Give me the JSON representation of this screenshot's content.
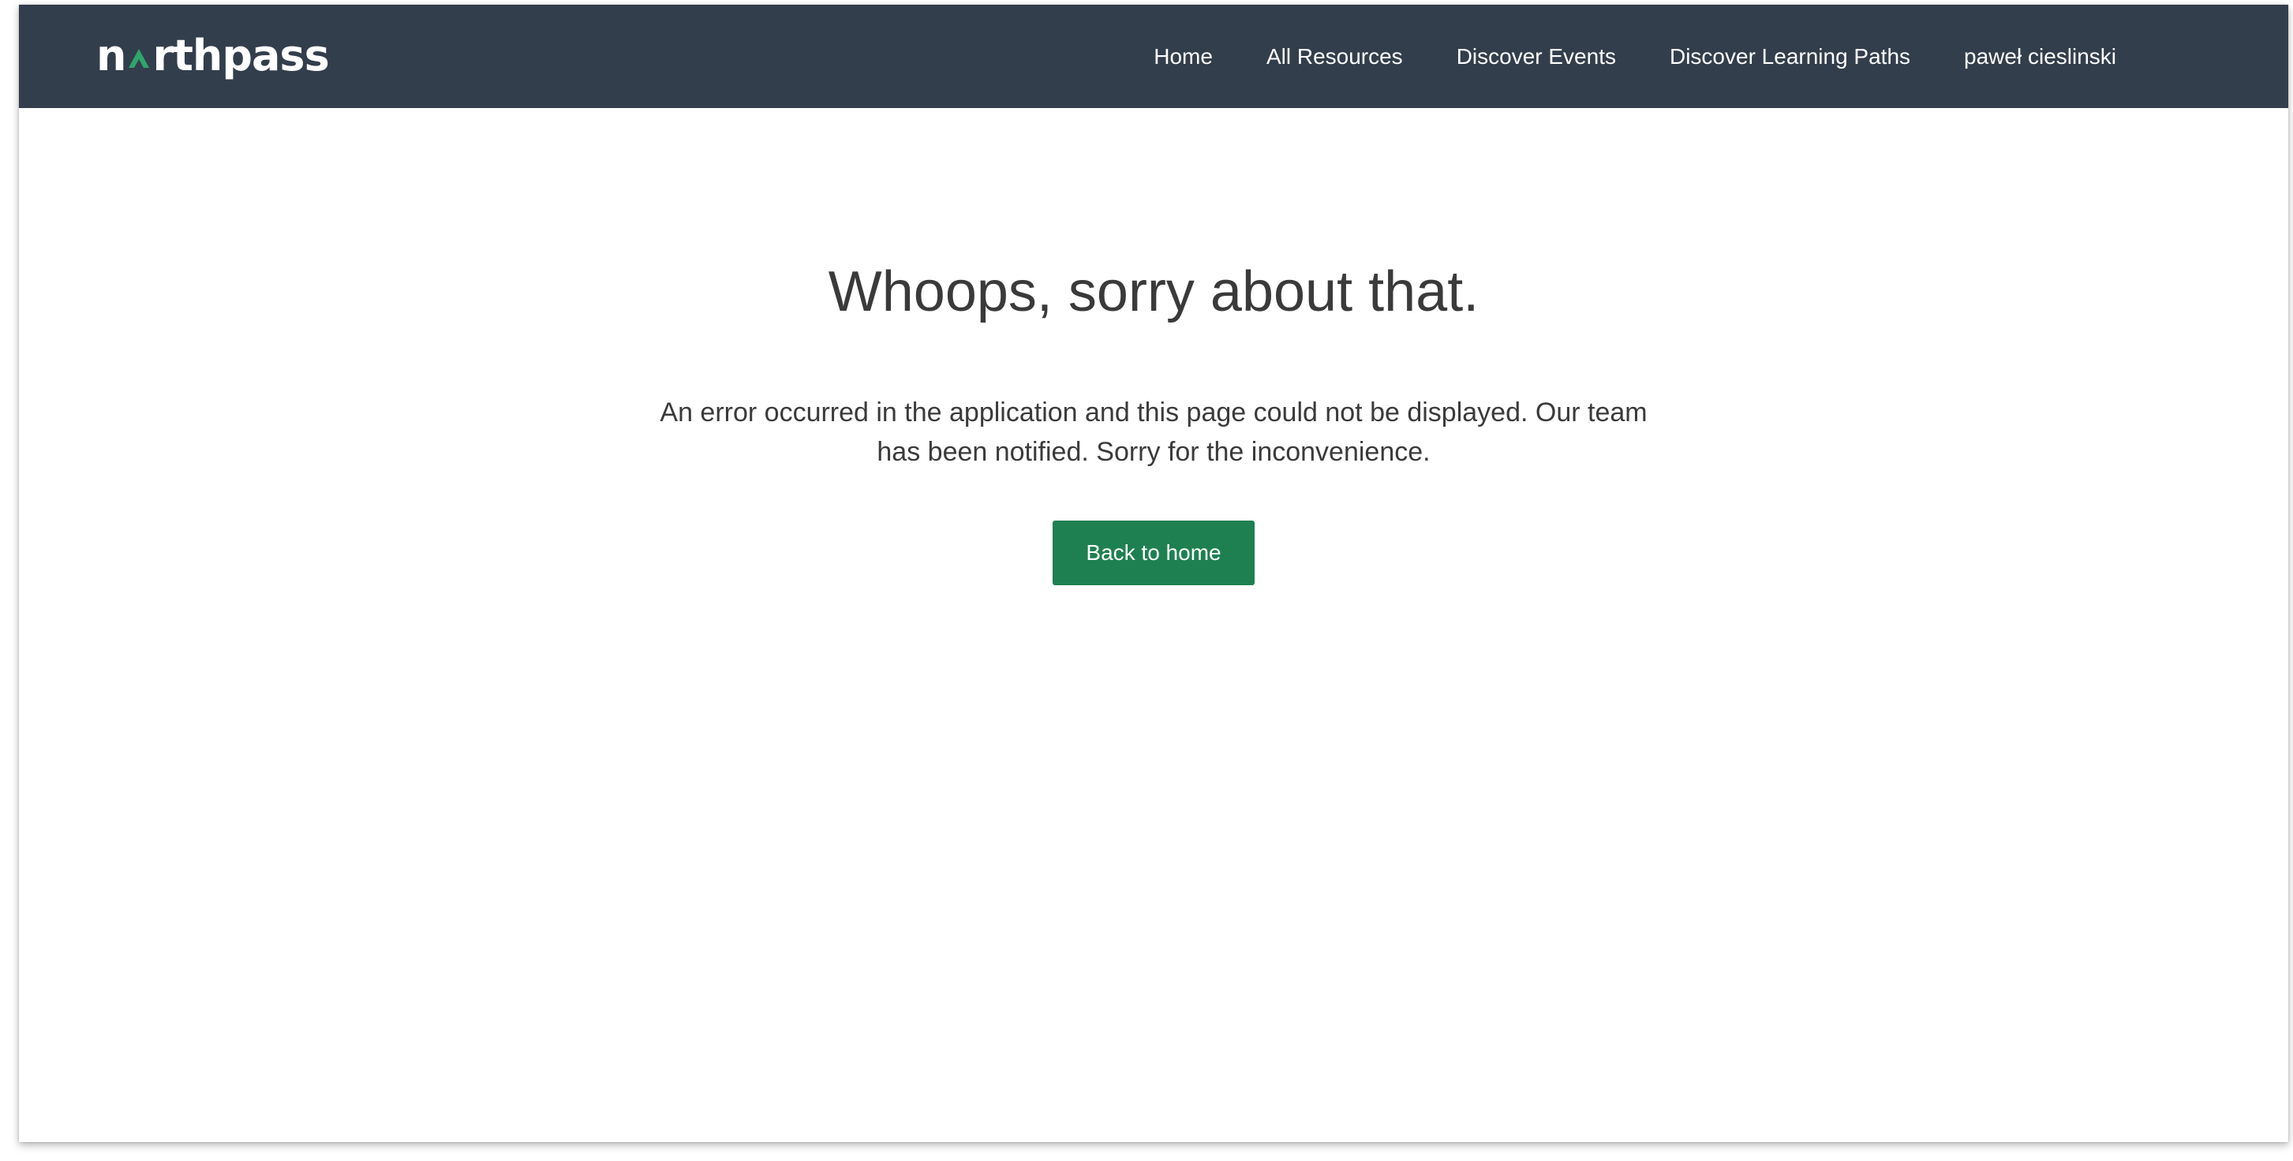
{
  "header": {
    "logo": {
      "text_before_mark": "n",
      "text_after_mark": "rthpass",
      "mark_icon": "mountain-peak-icon"
    },
    "nav": [
      {
        "label": "Home"
      },
      {
        "label": "All Resources"
      },
      {
        "label": "Discover Events"
      },
      {
        "label": "Discover Learning Paths"
      },
      {
        "label": "paweł cieslinski"
      }
    ]
  },
  "main": {
    "title": "Whoops, sorry about that.",
    "message": "An error occurred in the application and this page could not be displayed. Our team has been notified. Sorry for the inconvenience.",
    "back_button_label": "Back to home"
  },
  "colors": {
    "navbar_background": "#333e4c",
    "brand_green": "#1e8050",
    "logo_accent": "#2fa56b",
    "text_dark": "#3a3a3a"
  }
}
